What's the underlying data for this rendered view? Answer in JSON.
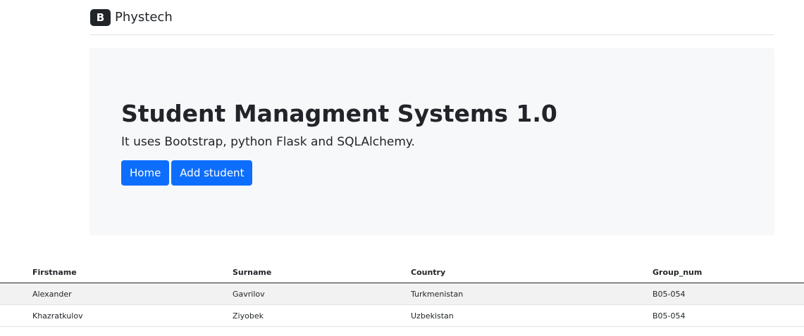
{
  "navbar": {
    "logo_letter": "B",
    "brand": "Phystech"
  },
  "hero": {
    "title": "Student Managment Systems 1.0",
    "lead": "It uses Bootstrap, python Flask and SQLAlchemy.",
    "buttons": {
      "home": "Home",
      "add_student": "Add student"
    },
    "accent_color": "#0d6efd",
    "background_color": "#f7f8fa"
  },
  "table": {
    "headers": [
      "Firstname",
      "Surname",
      "Country",
      "Group_num"
    ],
    "rows": [
      [
        "Alexander",
        "Gavrilov",
        "Turkmenistan",
        "B05-054"
      ],
      [
        "Khazratkulov",
        "Ziyobek",
        "Uzbekistan",
        "B05-054"
      ]
    ]
  }
}
